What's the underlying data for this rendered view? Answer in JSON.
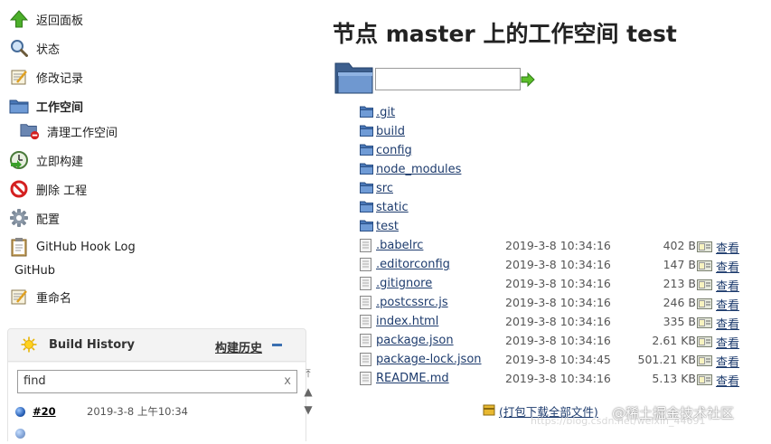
{
  "sidebar": {
    "tasks": [
      {
        "label": "返回面板",
        "icon": "up-arrow-icon"
      },
      {
        "label": "状态",
        "icon": "magnifier-icon"
      },
      {
        "label": "修改记录",
        "icon": "notepad-icon"
      },
      {
        "label": "工作空间",
        "icon": "folder-icon"
      },
      {
        "label": "清理工作空间",
        "icon": "folder-delete-icon"
      },
      {
        "label": "立即构建",
        "icon": "build-clock-icon"
      },
      {
        "label": "删除 工程",
        "icon": "no-entry-icon"
      },
      {
        "label": "配置",
        "icon": "gear-icon"
      },
      {
        "label": "GitHub Hook Log",
        "icon": "clipboard-icon"
      },
      {
        "label": "GitHub"
      },
      {
        "label": "重命名",
        "icon": "notepad-icon"
      }
    ]
  },
  "build_history": {
    "title": "Build History",
    "trend_label": "构建历史",
    "filter_value": "find",
    "clear_label": "x",
    "builds": [
      {
        "number": "#20",
        "date": "2019-3-8 上午10:34"
      }
    ]
  },
  "main": {
    "title": "节点 master 上的工作空间 test",
    "path_value": "",
    "view_label": "查看",
    "zip_label": "(打包下载全部文件)",
    "files": [
      {
        "name": ".git",
        "type": "dir"
      },
      {
        "name": "build",
        "type": "dir"
      },
      {
        "name": "config",
        "type": "dir"
      },
      {
        "name": "node_modules",
        "type": "dir"
      },
      {
        "name": "src",
        "type": "dir"
      },
      {
        "name": "static",
        "type": "dir"
      },
      {
        "name": "test",
        "type": "dir"
      },
      {
        "name": ".babelrc",
        "type": "file",
        "date": "2019-3-8 10:34:16",
        "size": "402 B"
      },
      {
        "name": ".editorconfig",
        "type": "file",
        "date": "2019-3-8 10:34:16",
        "size": "147 B"
      },
      {
        "name": ".gitignore",
        "type": "file",
        "date": "2019-3-8 10:34:16",
        "size": "213 B"
      },
      {
        "name": ".postcssrc.js",
        "type": "file",
        "date": "2019-3-8 10:34:16",
        "size": "246 B"
      },
      {
        "name": "index.html",
        "type": "file",
        "date": "2019-3-8 10:34:16",
        "size": "335 B"
      },
      {
        "name": "package.json",
        "type": "file",
        "date": "2019-3-8 10:34:16",
        "size": "2.61 KB"
      },
      {
        "name": "package-lock.json",
        "type": "file",
        "date": "2019-3-8 10:34:45",
        "size": "501.21 KB"
      },
      {
        "name": "README.md",
        "type": "file",
        "date": "2019-3-8 10:34:16",
        "size": "5.13 KB"
      }
    ]
  },
  "watermark": {
    "text": "@稀土掘金技术社区",
    "faint": "https://blog.csdn.net/weixin_44691"
  },
  "colors": {
    "link": "#1e3c6e",
    "folder": "#4a78b8",
    "panel": "#f3f3f3"
  }
}
